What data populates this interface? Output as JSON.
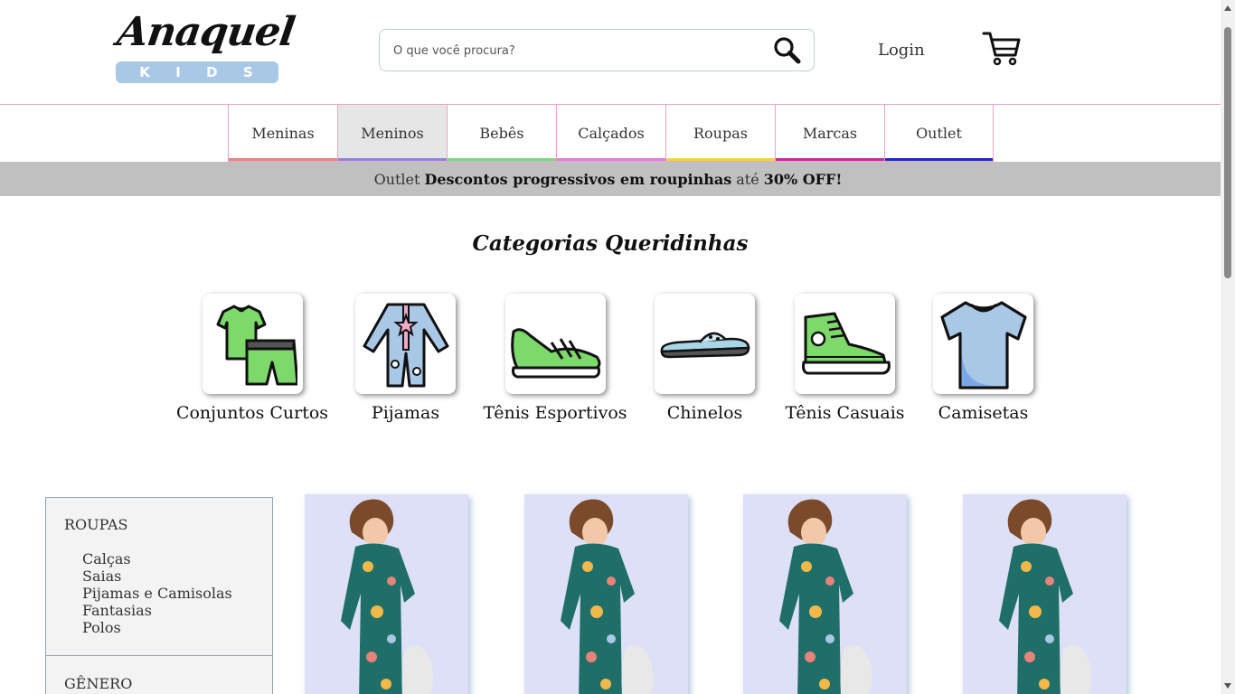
{
  "header": {
    "logo_script": "Anaquel",
    "logo_letters": [
      "K",
      "I",
      "D",
      "S"
    ],
    "search_placeholder": "O que você procura?",
    "login_label": "Login"
  },
  "nav": {
    "items": [
      {
        "label": "Meninas",
        "color": "#e8837a",
        "active": false
      },
      {
        "label": "Meninos",
        "color": "#8a86e0",
        "active": true
      },
      {
        "label": "Bebês",
        "color": "#7ed97a",
        "active": false
      },
      {
        "label": "Calçados",
        "color": "#e67ce0",
        "active": false
      },
      {
        "label": "Roupas",
        "color": "#e9d84b",
        "active": false
      },
      {
        "label": "Marcas",
        "color": "#c52aa0",
        "active": false
      },
      {
        "label": "Outlet",
        "color": "#2228b8",
        "active": false
      }
    ]
  },
  "promo": {
    "prefix": "Outlet",
    "highlight": "Descontos progressivos em roupinhas",
    "middle": "até",
    "discount": "30% OFF!"
  },
  "categories": {
    "title": "Categorias Queridinhas",
    "items": [
      {
        "label": "Conjuntos Curtos",
        "icon": "shorts-set-icon"
      },
      {
        "label": "Pijamas",
        "icon": "pajamas-icon"
      },
      {
        "label": "Tênis Esportivos",
        "icon": "sport-sneaker-icon"
      },
      {
        "label": "Chinelos",
        "icon": "flip-flop-icon"
      },
      {
        "label": "Tênis Casuais",
        "icon": "casual-sneaker-icon"
      },
      {
        "label": "Camisetas",
        "icon": "tshirt-icon"
      }
    ]
  },
  "sidebar": {
    "section1_title": "ROUPAS",
    "items": [
      "Calças",
      "Saias",
      "Pijamas e Camisolas",
      "Fantasias",
      "Polos"
    ],
    "section2_title": "GÊNERO"
  },
  "products": [
    {
      "image": "child-pajama-photo"
    },
    {
      "image": "child-pajama-photo"
    },
    {
      "image": "child-pajama-photo"
    },
    {
      "image": "child-pajama-photo"
    }
  ],
  "colors": {
    "accent_pink": "#e9a6c4",
    "promo_bg": "#c0c0c0",
    "logo_blue": "#a9c8e6",
    "product_bg": "#dde0f7",
    "pajama_teal": "#1f6f68"
  }
}
